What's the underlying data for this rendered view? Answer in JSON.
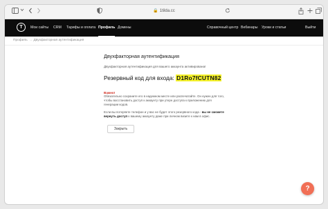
{
  "browser": {
    "url": "1tilda.cc",
    "icons": {
      "sidebar": "sidebar-icon",
      "chevron": "chevron-down-icon",
      "back": "back-arrow-icon",
      "forward": "forward-arrow-icon",
      "shield": "shield-icon",
      "lock": "lock-icon",
      "reload": "reload-icon",
      "share": "share-icon",
      "new_tab": "new-tab-icon",
      "tabs": "tabs-overview-icon"
    }
  },
  "site": {
    "logo": "T",
    "nav_left": [
      "Мои сайты",
      "CRM",
      "Тарифы и оплата",
      "Профиль",
      "Домены"
    ],
    "active_nav": "Профиль",
    "nav_right": [
      "Справочный центр",
      "Вебинары",
      "Уроки и статьи",
      "Выйти"
    ]
  },
  "breadcrumb": {
    "parent": "Профиль",
    "separator": "→",
    "current": "Двухфакторная аутентификация"
  },
  "main": {
    "title": "Двухфакторная аутентификация",
    "status": "Двухфакторная аутентификация для вашего аккаунта активирована!",
    "backup_label": "Резервный код для входа:",
    "backup_code": "D1Ro7fCUTN82",
    "warning_title": "Важно!",
    "paragraph1": "Обязательно сохраните его в надежном месте или распечатайте. Он нужен для того, чтобы восстановить доступ к аккаунту при утере доступа к приложению для генерации кодов.",
    "paragraph2_prefix": "Если вы потеряете телефон и у вас не будет этого резервного кода - ",
    "paragraph2_bold": "вы не сможете вернуть доступ",
    "paragraph2_suffix": " к вашему аккаунту даже при личном визите к нам в офис.",
    "close_label": "Закрыть"
  },
  "help_fab": "?",
  "colors": {
    "header_bg": "#0c0c0c",
    "code_highlight": "#f5f22a",
    "warning": "#d0281b",
    "help_fab": "#f16f56"
  }
}
